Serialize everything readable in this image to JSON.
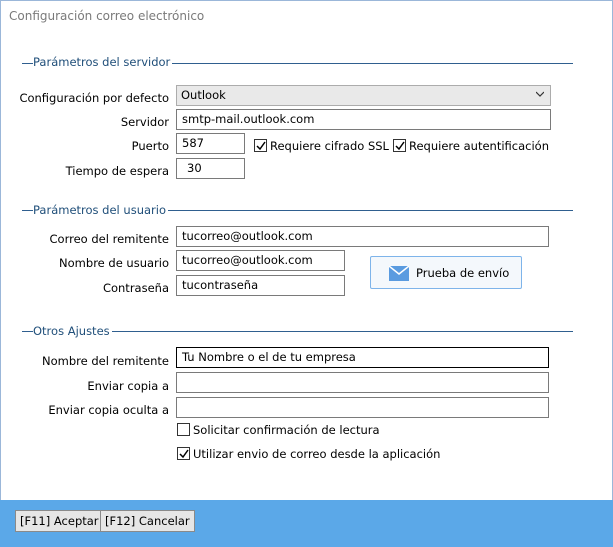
{
  "window": {
    "title": "Configuración correo electrónico"
  },
  "server": {
    "legend": "Parámetros del servidor",
    "default_label": "Configuración por defecto",
    "default_value": "Outlook",
    "server_label": "Servidor",
    "server_value": "smtp-mail.outlook.com",
    "port_label": "Puerto",
    "port_value": "587",
    "ssl_label": "Requiere cifrado SSL",
    "ssl_checked": true,
    "auth_label": "Requiere autentificación",
    "auth_checked": true,
    "timeout_label": "Tiempo de espera",
    "timeout_value": "30"
  },
  "user": {
    "legend": "Parámetros del usuario",
    "sender_label": "Correo del remitente",
    "sender_value": "tucorreo@outlook.com",
    "username_label": "Nombre de usuario",
    "username_value": "tucorreo@outlook.com",
    "password_label": "Contraseña",
    "password_value": "tucontraseña",
    "test_button": "Prueba de envío"
  },
  "other": {
    "legend": "Otros Ajustes",
    "sender_name_label": "Nombre del remitente",
    "sender_name_value": "Tu Nombre o el de tu empresa",
    "cc_label": "Enviar copia a",
    "cc_value": "",
    "bcc_label": "Enviar copia oculta a",
    "bcc_value": "",
    "read_receipt_label": "Solicitar confirmación de lectura",
    "read_receipt_checked": false,
    "app_send_label": "Utilizar envio de correo desde la aplicación",
    "app_send_checked": true
  },
  "footer": {
    "accept_label": "[F11] Aceptar",
    "cancel_label": "[F12] Cancelar"
  },
  "colors": {
    "footer_bg": "#5ba8e8",
    "legend_text": "#1f4e79",
    "button_border": "#7eb4ea"
  }
}
